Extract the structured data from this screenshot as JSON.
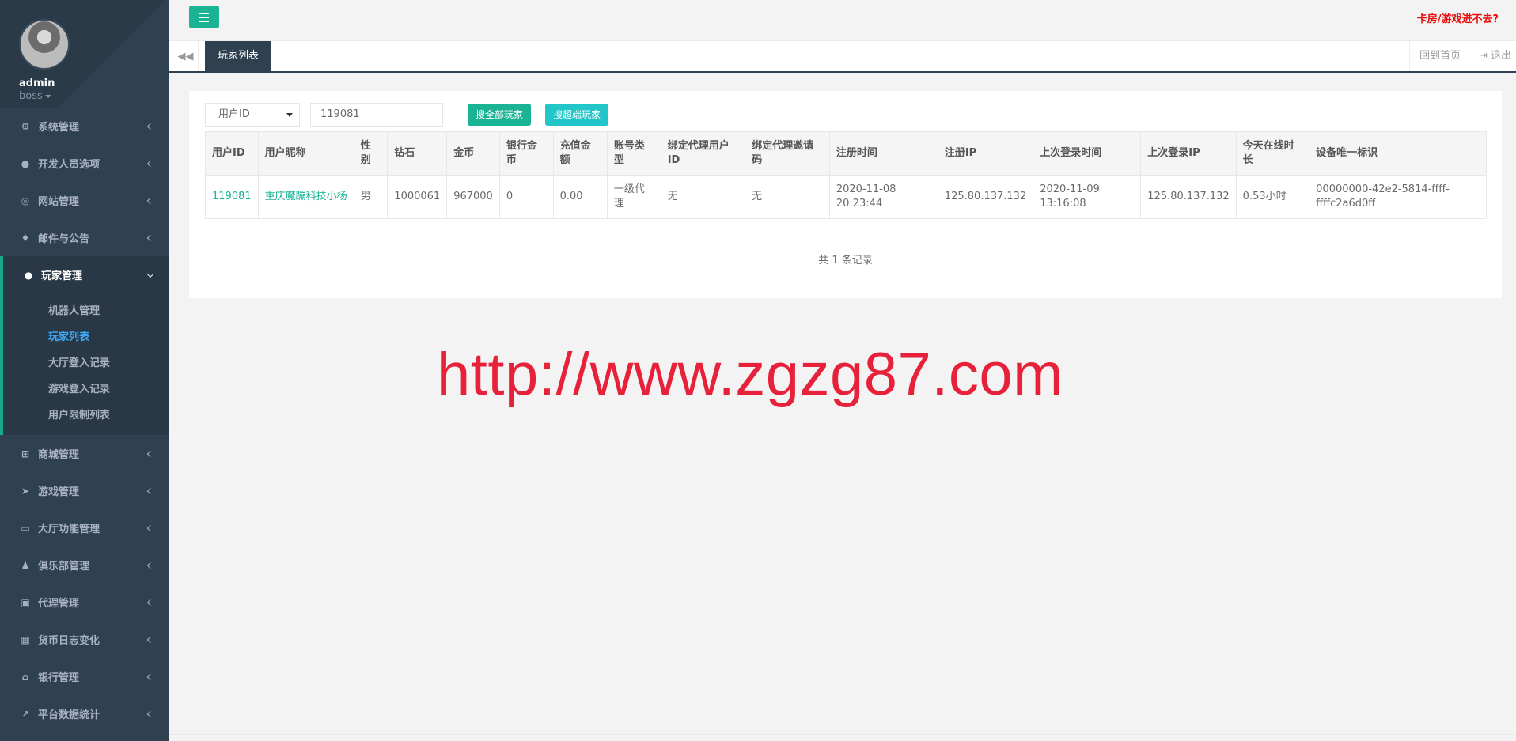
{
  "profile": {
    "name": "admin",
    "role": "boss"
  },
  "sidebar": {
    "items": [
      {
        "label": "系统管理",
        "icon": "cogs-icon"
      },
      {
        "label": "开发人员选项",
        "icon": "gamepad-icon"
      },
      {
        "label": "网站管理",
        "icon": "globe-icon"
      },
      {
        "label": "邮件与公告",
        "icon": "bell-icon"
      },
      {
        "label": "玩家管理",
        "icon": "user-icon"
      },
      {
        "label": "商城管理",
        "icon": "cart-icon"
      },
      {
        "label": "游戏管理",
        "icon": "rocket-icon"
      },
      {
        "label": "大厅功能管理",
        "icon": "desktop-icon"
      },
      {
        "label": "俱乐部管理",
        "icon": "users-icon"
      },
      {
        "label": "代理管理",
        "icon": "lock-icon"
      },
      {
        "label": "货币日志变化",
        "icon": "calendar-icon"
      },
      {
        "label": "银行管理",
        "icon": "bank-icon"
      },
      {
        "label": "平台数据统计",
        "icon": "chart-line-icon"
      }
    ],
    "sub_items": [
      {
        "label": "机器人管理"
      },
      {
        "label": "玩家列表"
      },
      {
        "label": "大厅登入记录"
      },
      {
        "label": "游戏登入记录"
      },
      {
        "label": "用户限制列表"
      }
    ]
  },
  "topbar": {
    "help_link": "卡房/游戏进不去?"
  },
  "tabs": {
    "active": "玩家列表",
    "home": "回到首页",
    "exit": "退出"
  },
  "search": {
    "field_select": "用户ID",
    "value": "119081",
    "btn_all": "搜全部玩家",
    "btn_super": "搜超端玩家"
  },
  "table": {
    "headers": [
      "用户ID",
      "用户昵称",
      "性别",
      "钻石",
      "金币",
      "银行金币",
      "充值金额",
      "账号类型",
      "绑定代理用户ID",
      "绑定代理邀请码",
      "注册时间",
      "注册IP",
      "上次登录时间",
      "上次登录IP",
      "今天在线时长",
      "设备唯一标识"
    ],
    "rows": [
      [
        "119081",
        "重庆魔蹦科技小杨",
        "男",
        "1000061",
        "967000",
        "0",
        "0.00",
        "一级代理",
        "无",
        "无",
        "2020-11-08 20:23:44",
        "125.80.137.132",
        "2020-11-09 13:16:08",
        "125.80.137.132",
        "0.53小时",
        "00000000-42e2-5814-ffff-ffffc2a6d0ff"
      ]
    ]
  },
  "record_count": "共 1 条记录",
  "watermark": "http://www.zgzg87.com",
  "colors": {
    "sidebar": "#2f4050",
    "accent": "#1ab394",
    "info": "#23c6c8",
    "link_red": "#ed0909",
    "watermark": "#e8213a"
  }
}
